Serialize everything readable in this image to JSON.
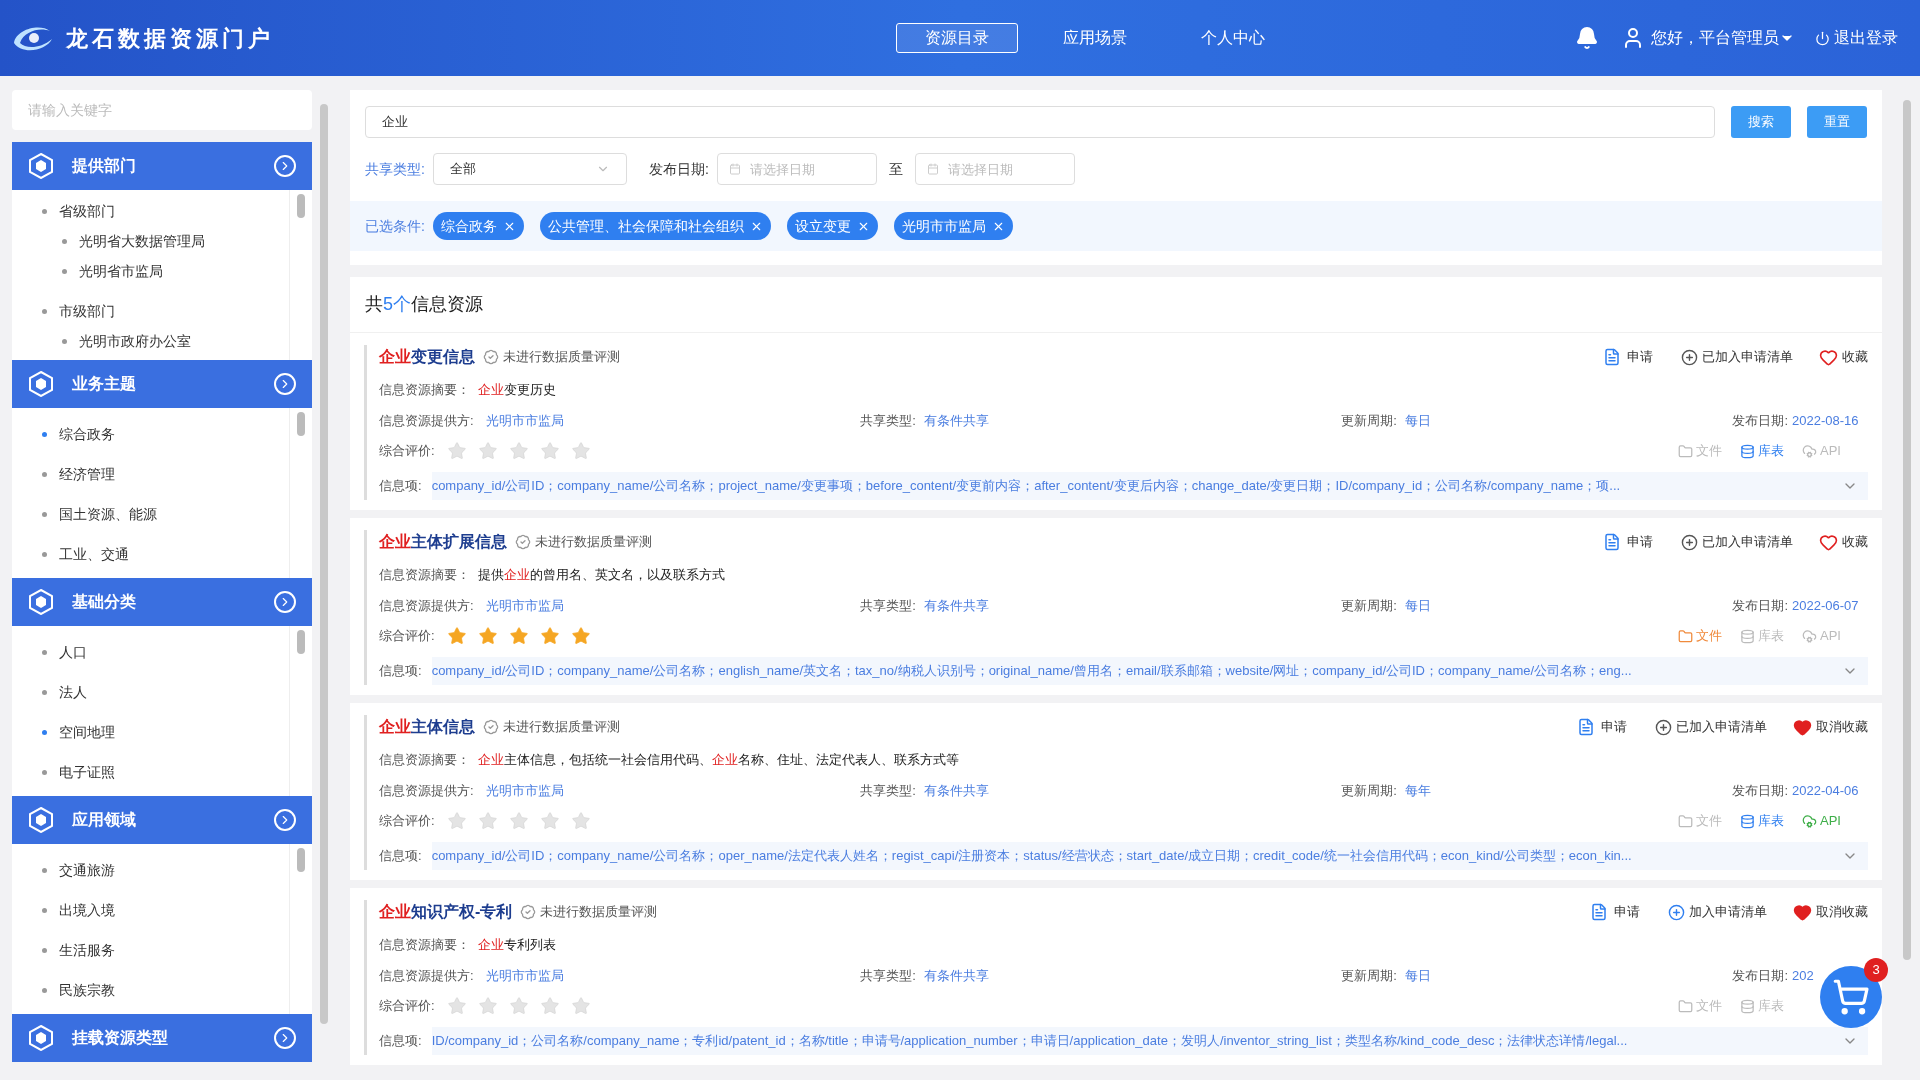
{
  "header": {
    "title": "龙石数据资源门户",
    "nav": [
      {
        "label": "资源目录",
        "selected": true
      },
      {
        "label": "应用场景",
        "selected": false
      },
      {
        "label": "个人中心",
        "selected": false
      }
    ],
    "user": "您好，平台管理员",
    "logout": "退出登录"
  },
  "sidebar": {
    "search": {
      "placeholder": "请输入关键字"
    },
    "sections": [
      {
        "title": "提供部门",
        "items": [
          {
            "label": "省级部门",
            "selected": false,
            "children": [
              {
                "label": "光明省大数据管理局",
                "selected": false
              },
              {
                "label": "光明省市监局",
                "selected": false
              }
            ]
          },
          {
            "label": "市级部门",
            "selected": false,
            "children": [
              {
                "label": "光明市政府办公室",
                "selected": false
              }
            ]
          }
        ]
      },
      {
        "title": "业务主题",
        "items": [
          {
            "label": "综合政务",
            "selected": true
          },
          {
            "label": "经济管理",
            "selected": false
          },
          {
            "label": "国土资源、能源",
            "selected": false
          },
          {
            "label": "工业、交通",
            "selected": false
          }
        ]
      },
      {
        "title": "基础分类",
        "items": [
          {
            "label": "人口",
            "selected": false
          },
          {
            "label": "法人",
            "selected": false
          },
          {
            "label": "空间地理",
            "selected": true
          },
          {
            "label": "电子证照",
            "selected": false
          }
        ]
      },
      {
        "title": "应用领域",
        "items": [
          {
            "label": "交通旅游",
            "selected": false
          },
          {
            "label": "出境入境",
            "selected": false
          },
          {
            "label": "生活服务",
            "selected": false
          },
          {
            "label": "民族宗教",
            "selected": false
          }
        ]
      },
      {
        "title": "挂载资源类型"
      }
    ]
  },
  "search": {
    "value": "企业",
    "search_button": "搜索",
    "reset_button": "重置",
    "share_type_label": "共享类型:",
    "share_type": "全部",
    "date_label": "发布日期:",
    "date_from": {
      "placeholder": "请选择日期"
    },
    "date_sep": "至",
    "date_to": {
      "placeholder": "请选择日期"
    },
    "conditions_label": "已选条件:",
    "conditions": [
      "综合政务",
      "公共管理、社会保障和社会组织",
      "设立变更",
      "光明市市监局"
    ]
  },
  "results": {
    "count_prefix": "共",
    "count": "5个",
    "count_suffix": "信息资源",
    "items": [
      {
        "title": [
          {
            "text": "企业",
            "highlight": true
          },
          {
            "text": "变更信息",
            "highlight": false
          }
        ],
        "quality": "未进行数据质量评测",
        "apply": "申请",
        "cart": {
          "label": "已加入申请清单",
          "added": true
        },
        "favorite": {
          "label": "收藏",
          "on": false
        },
        "summary_label": "信息资源摘要：",
        "summary": [
          {
            "text": "企业",
            "highlight": true
          },
          {
            "text": "变更历史",
            "highlight": false
          }
        ],
        "provider_label": "信息资源提供方:",
        "provider": "光明市市监局",
        "share_label": "共享类型:",
        "share": "有条件共享",
        "cycle_label": "更新周期:",
        "cycle": "每日",
        "date_label": "发布日期:",
        "date": "2022-08-16",
        "rating_label": "综合评价:",
        "stars": 0,
        "formats": [
          {
            "kind": "file",
            "label": "文件",
            "enabled": false
          },
          {
            "kind": "table",
            "label": "库表",
            "enabled": true
          },
          {
            "kind": "api",
            "label": "API",
            "enabled": false
          }
        ],
        "fields_label": "信息项:",
        "fields": "company_id/公司ID；company_name/公司名称；project_name/变更事项；before_content/变更前内容；after_content/变更后内容；change_date/变更日期；ID/company_id；公司名称/company_name；项..."
      },
      {
        "title": [
          {
            "text": "企业",
            "highlight": true
          },
          {
            "text": "主体扩展信息",
            "highlight": false
          }
        ],
        "quality": "未进行数据质量评测",
        "apply": "申请",
        "cart": {
          "label": "已加入申请清单",
          "added": true
        },
        "favorite": {
          "label": "收藏",
          "on": false
        },
        "summary_label": "信息资源摘要：",
        "summary": [
          {
            "text": "提供",
            "highlight": false
          },
          {
            "text": "企业",
            "highlight": true
          },
          {
            "text": "的曾用名、英文名，以及联系方式",
            "highlight": false
          }
        ],
        "provider_label": "信息资源提供方:",
        "provider": "光明市市监局",
        "share_label": "共享类型:",
        "share": "有条件共享",
        "cycle_label": "更新周期:",
        "cycle": "每日",
        "date_label": "发布日期:",
        "date": "2022-06-07",
        "rating_label": "综合评价:",
        "stars": 5,
        "formats": [
          {
            "kind": "file",
            "label": "文件",
            "enabled": true
          },
          {
            "kind": "table",
            "label": "库表",
            "enabled": false
          },
          {
            "kind": "api",
            "label": "API",
            "enabled": false
          }
        ],
        "fields_label": "信息项:",
        "fields": "company_id/公司ID；company_name/公司名称；english_name/英文名；tax_no/纳税人识别号；original_name/曾用名；email/联系邮箱；website/网址；company_id/公司ID；company_name/公司名称；eng..."
      },
      {
        "title": [
          {
            "text": "企业",
            "highlight": true
          },
          {
            "text": "主体信息",
            "highlight": false
          }
        ],
        "quality": "未进行数据质量评测",
        "apply": "申请",
        "cart": {
          "label": "已加入申请清单",
          "added": true
        },
        "favorite": {
          "label": "取消收藏",
          "on": true
        },
        "summary_label": "信息资源摘要：",
        "summary": [
          {
            "text": "企业",
            "highlight": true
          },
          {
            "text": "主体信息，包括统一社会信用代码、",
            "highlight": false
          },
          {
            "text": "企业",
            "highlight": true
          },
          {
            "text": "名称、住址、法定代表人、联系方式等",
            "highlight": false
          }
        ],
        "provider_label": "信息资源提供方:",
        "provider": "光明市市监局",
        "share_label": "共享类型:",
        "share": "有条件共享",
        "cycle_label": "更新周期:",
        "cycle": "每年",
        "date_label": "发布日期:",
        "date": "2022-04-06",
        "rating_label": "综合评价:",
        "stars": 0,
        "formats": [
          {
            "kind": "file",
            "label": "文件",
            "enabled": false
          },
          {
            "kind": "table",
            "label": "库表",
            "enabled": true
          },
          {
            "kind": "api",
            "label": "API",
            "enabled": true
          }
        ],
        "fields_label": "信息项:",
        "fields": "company_id/公司ID；company_name/公司名称；oper_name/法定代表人姓名；regist_capi/注册资本；status/经营状态；start_date/成立日期；credit_code/统一社会信用代码；econ_kind/公司类型；econ_kin..."
      },
      {
        "title": [
          {
            "text": "企业",
            "highlight": true
          },
          {
            "text": "知识产权-专利",
            "highlight": false
          }
        ],
        "quality": "未进行数据质量评测",
        "apply": "申请",
        "cart": {
          "label": "加入申请清单",
          "added": false
        },
        "favorite": {
          "label": "取消收藏",
          "on": true
        },
        "summary_label": "信息资源摘要：",
        "summary": [
          {
            "text": "企业",
            "highlight": true
          },
          {
            "text": "专利列表",
            "highlight": false
          }
        ],
        "provider_label": "信息资源提供方:",
        "provider": "光明市市监局",
        "share_label": "共享类型:",
        "share": "有条件共享",
        "cycle_label": "更新周期:",
        "cycle": "每日",
        "date_label": "发布日期:",
        "date": "202",
        "rating_label": "综合评价:",
        "stars": 0,
        "formats": [
          {
            "kind": "file",
            "label": "文件",
            "enabled": false
          },
          {
            "kind": "table",
            "label": "库表",
            "enabled": false
          }
        ],
        "fields_label": "信息项:",
        "fields": "ID/company_id；公司名称/company_name；专利id/patent_id；名称/title；申请号/application_number；申请日/application_date；发明人/inventor_string_list；类型名称/kind_code_desc；法律状态详情/legal..."
      }
    ]
  },
  "cart_badge": "3"
}
